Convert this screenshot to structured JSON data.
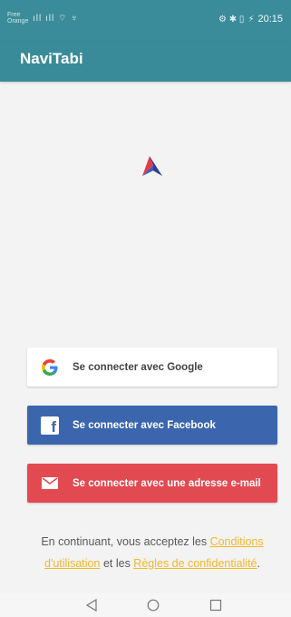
{
  "status_bar": {
    "carrier_line1": "Free",
    "carrier_line2": "Orange",
    "left_icons": "ıll ıll ⌔ ♆",
    "right_icons": "⚙ ✱ ▯",
    "battery": "⚡",
    "time": "20:15"
  },
  "app_bar": {
    "title": "NaviTabi"
  },
  "buttons": {
    "google_label": "Se connecter avec Google",
    "facebook_label": "Se connecter avec Facebook",
    "email_label": "Se connecter avec une adresse e-mail"
  },
  "terms": {
    "prefix": "En continuant, vous acceptez les ",
    "conditions_link": "Conditions d'utilisation",
    "middle": " et les ",
    "privacy_link": "Règles de confidentialité",
    "suffix": "."
  },
  "icons": {
    "logo": "navitabi-logo-icon",
    "google": "google-icon",
    "facebook": "facebook-icon",
    "email": "envelope-icon",
    "back": "back-triangle-icon",
    "home": "home-circle-icon",
    "recent": "recent-square-icon"
  },
  "colors": {
    "primary": "#3a8b99",
    "facebook": "#3b66ad",
    "email": "#e24a52",
    "link": "#f0b82a"
  }
}
